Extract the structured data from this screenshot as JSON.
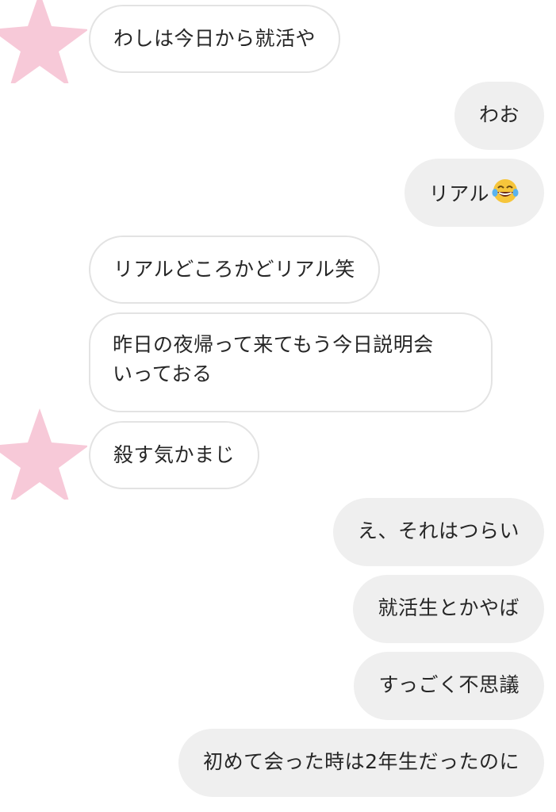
{
  "colors": {
    "incoming_bg": "#ffffff",
    "incoming_border": "#e3e3e3",
    "outgoing_bg": "#efefef",
    "text": "#262626",
    "avatar_star": "#f7c9d8"
  },
  "avatar": {
    "icon": "pink-star-sticker-icon"
  },
  "messages": [
    {
      "side": "in",
      "text": "わしは今日から就活や"
    },
    {
      "side": "out",
      "text": "わお"
    },
    {
      "side": "out",
      "text": "リアル",
      "emoji": "face-with-tears-of-joy"
    },
    {
      "side": "in",
      "text": "リアルどころかどリアル笑"
    },
    {
      "side": "in",
      "lines": [
        "昨日の夜帰って来てもう今日説明会",
        "いっておる"
      ]
    },
    {
      "side": "in",
      "text": "殺す気かまじ"
    },
    {
      "side": "out",
      "text": "え、それはつらい"
    },
    {
      "side": "out",
      "text": "就活生とかやば"
    },
    {
      "side": "out",
      "text": "すっごく不思議"
    },
    {
      "side": "out",
      "text": "初めて会った時は2年生だったのに"
    }
  ]
}
